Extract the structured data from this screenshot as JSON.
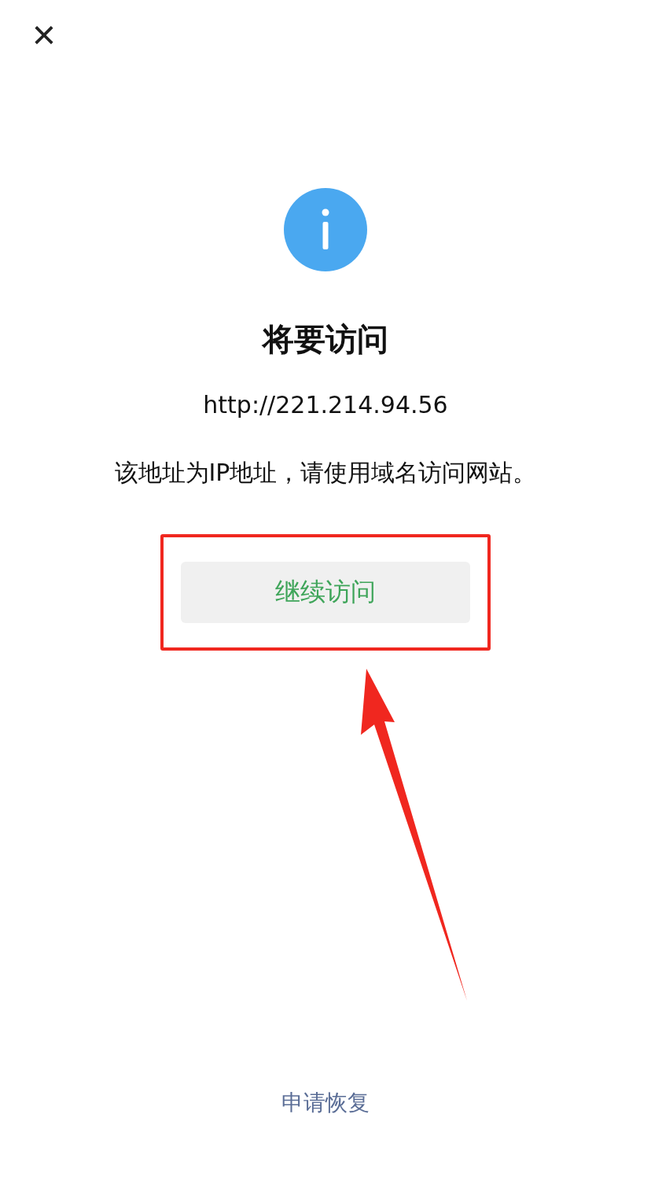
{
  "close": {
    "label": "×"
  },
  "notice": {
    "title": "将要访问",
    "url": "http://221.214.94.56",
    "message": "该地址为IP地址，请使用域名访问网站。"
  },
  "continue_button": {
    "label": "继续访问"
  },
  "footer_link": {
    "label": "申请恢复"
  }
}
